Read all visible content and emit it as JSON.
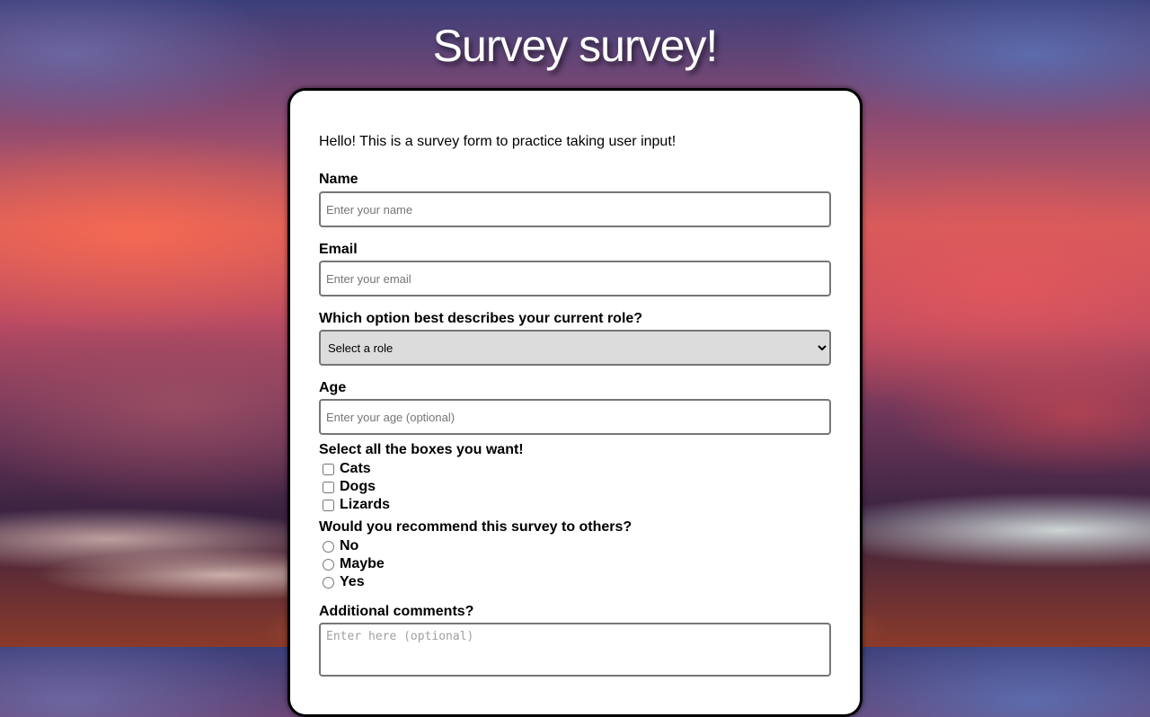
{
  "page": {
    "title": "Survey survey!"
  },
  "form": {
    "intro": "Hello! This is a survey form to practice taking user input!",
    "name": {
      "label": "Name",
      "placeholder": "Enter your name"
    },
    "email": {
      "label": "Email",
      "placeholder": "Enter your email"
    },
    "role": {
      "label": "Which option best describes your current role?",
      "selected": "Select a role"
    },
    "age": {
      "label": "Age",
      "placeholder": "Enter your age (optional)"
    },
    "checkboxes": {
      "label": "Select all the boxes you want!",
      "options": [
        "Cats",
        "Dogs",
        "Lizards"
      ]
    },
    "recommend": {
      "label": "Would you recommend this survey to others?",
      "options": [
        "No",
        "Maybe",
        "Yes"
      ]
    },
    "comments": {
      "label": "Additional comments?",
      "placeholder": "Enter here (optional)"
    }
  }
}
